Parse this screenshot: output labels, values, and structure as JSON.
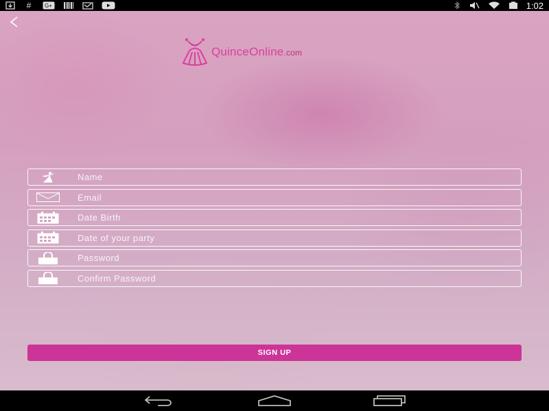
{
  "status_bar": {
    "time": "1:02",
    "left_icons": [
      "download-icon",
      "hash-icon",
      "gplus-icon",
      "barcode-icon",
      "bag-icon",
      "youtube-icon"
    ],
    "right_icons": [
      "bluetooth-icon",
      "mute-icon",
      "wifi-icon",
      "battery-icon"
    ]
  },
  "logo": {
    "brand": "QuinceOnline",
    "domain": ".com"
  },
  "form": {
    "fields": [
      {
        "placeholder": "Name",
        "icon": "dancer-icon"
      },
      {
        "placeholder": "Email",
        "icon": "envelope-icon"
      },
      {
        "placeholder": "Date Birth",
        "icon": "calendar-icon"
      },
      {
        "placeholder": "Date of your party",
        "icon": "calendar-icon"
      },
      {
        "placeholder": "Password",
        "icon": "lock-icon"
      },
      {
        "placeholder": "Confirm Password",
        "icon": "lock-icon"
      }
    ],
    "submit_label": "SIGN UP"
  },
  "colors": {
    "accent": "#cc3497",
    "logo": "#d93f9e"
  }
}
